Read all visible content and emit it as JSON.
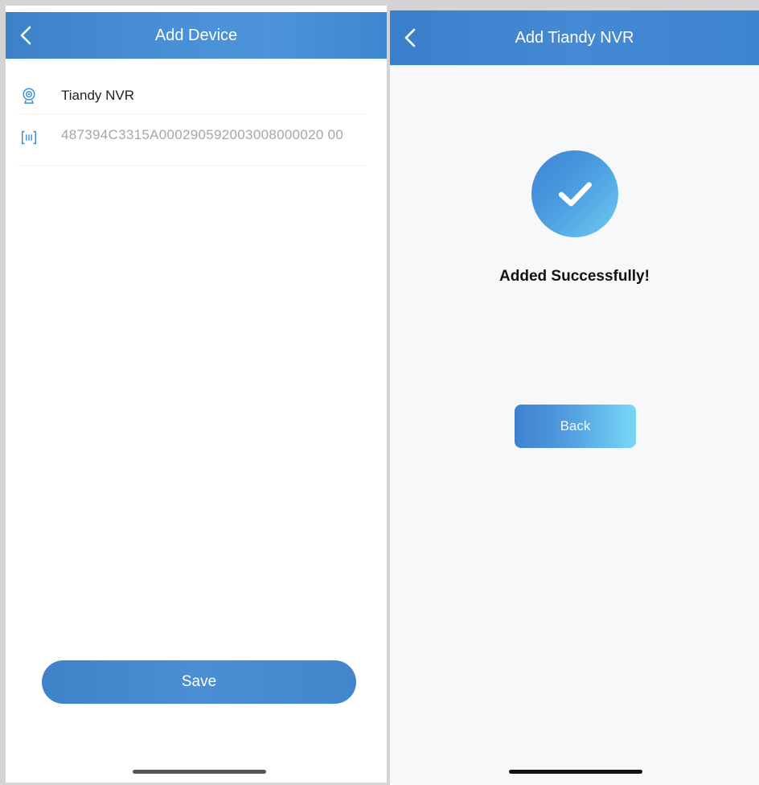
{
  "left_screen": {
    "header": {
      "title": "Add Device"
    },
    "device": {
      "name": "Tiandy NVR",
      "serial": "487394C3315A000290592003008000020 00"
    },
    "save_button": "Save"
  },
  "right_screen": {
    "header": {
      "title": "Add Tiandy NVR"
    },
    "message": "Added Successfully!",
    "back_button": "Back"
  },
  "colors": {
    "header_blue": "#4a8dd4",
    "button_blue": "#4a8dd2",
    "success_accent": "#6ccbf0"
  },
  "icons": [
    "chevron-left-icon",
    "camera-icon",
    "barcode-icon",
    "checkmark-icon"
  ]
}
